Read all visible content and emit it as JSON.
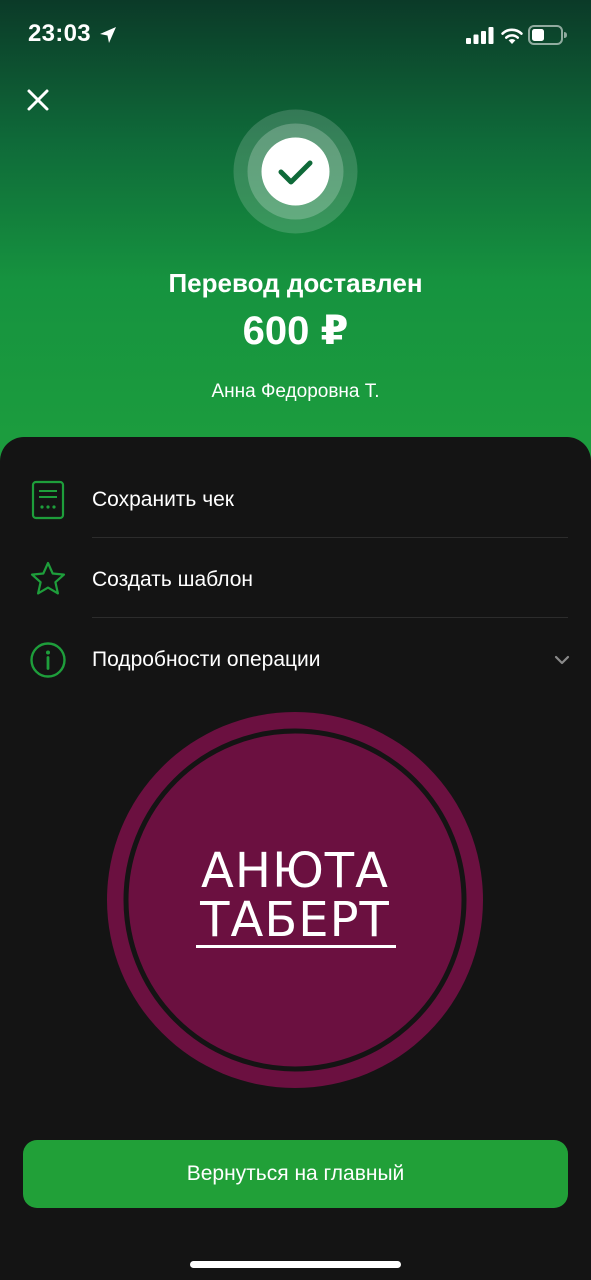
{
  "status_bar": {
    "time": "23:03",
    "icons": [
      "location-arrow-icon",
      "cellular-signal-icon",
      "wifi-icon",
      "battery-icon"
    ]
  },
  "header": {
    "close_icon": "close-icon",
    "status_icon": "checkmark-icon",
    "title": "Перевод доставлен",
    "amount": "600 ₽",
    "recipient": "Анна Федоровна Т."
  },
  "actions": [
    {
      "label": "Сохранить чек",
      "icon": "receipt-icon"
    },
    {
      "label": "Создать шаблон",
      "icon": "star-icon"
    },
    {
      "label": "Подробности операции",
      "icon": "info-icon",
      "trailing_icon": "chevron-down-icon"
    }
  ],
  "logo": {
    "line1": "АНЮТА",
    "line2": "ТАБЕРТ",
    "color": "#6b1040"
  },
  "footer": {
    "home_button_label": "Вернуться на главный"
  },
  "colors": {
    "accent_green": "#21a038",
    "icon_green": "#1e9e3b",
    "background": "#141414"
  }
}
